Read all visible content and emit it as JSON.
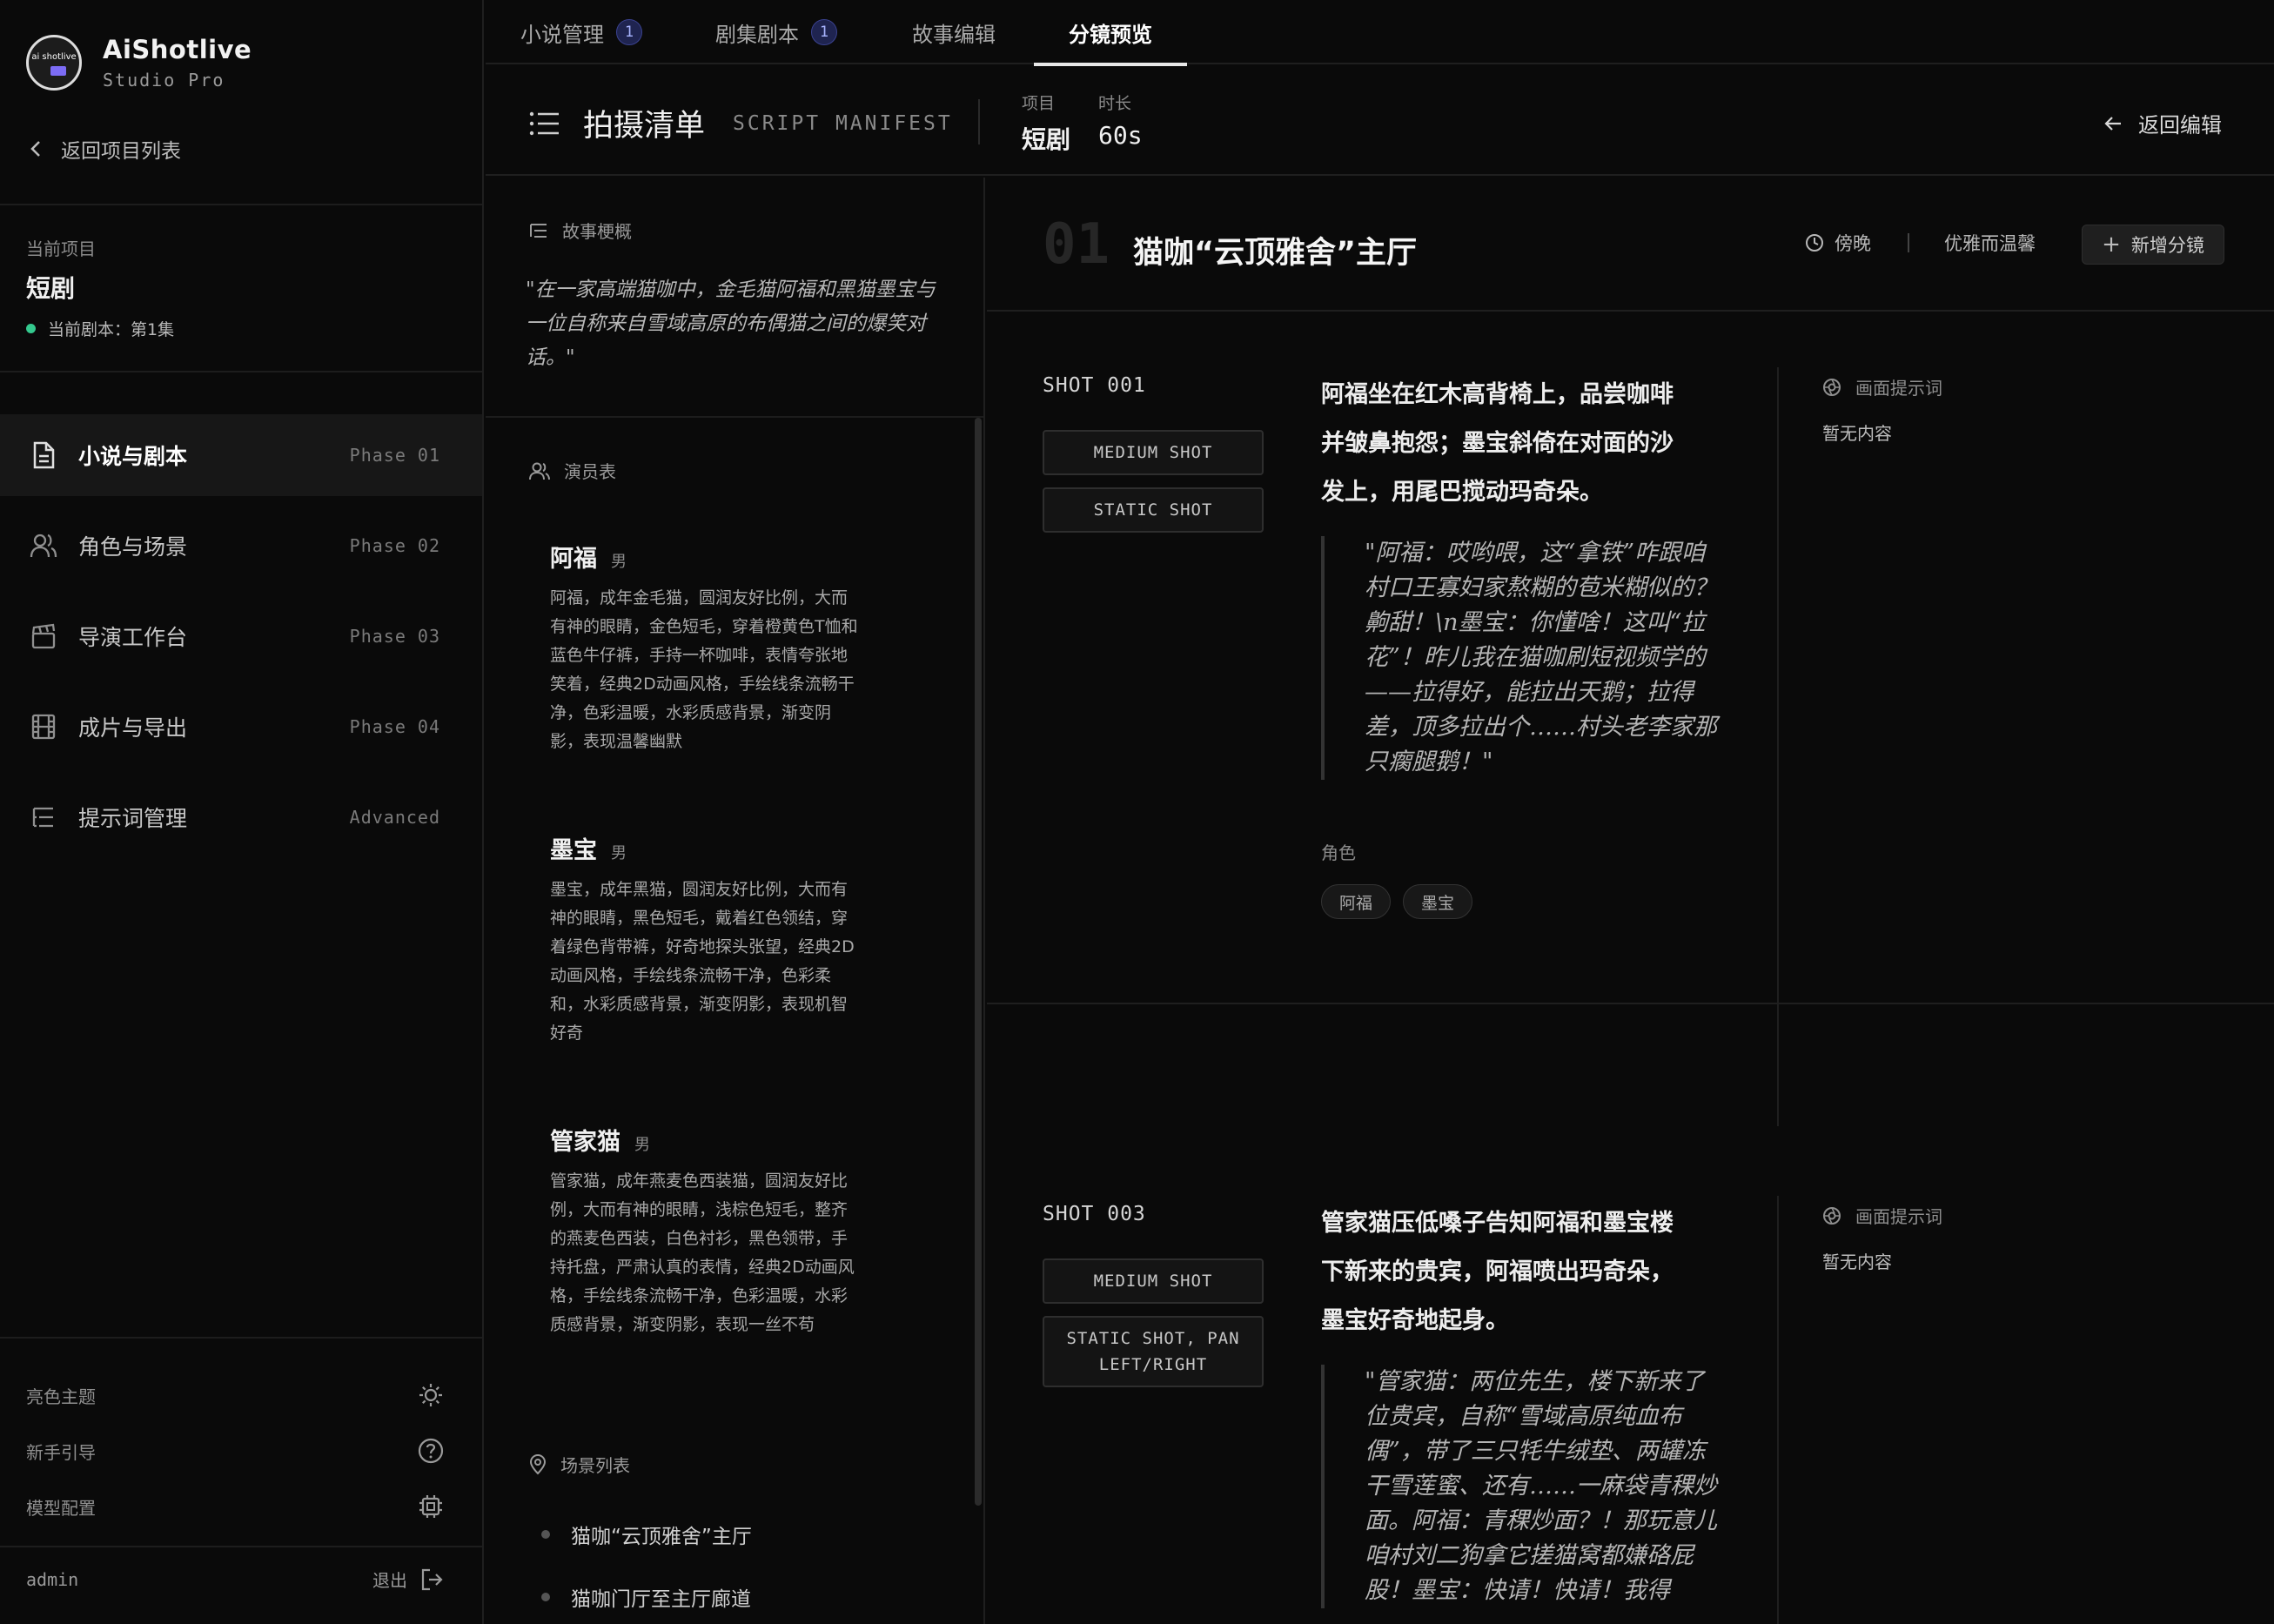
{
  "brand": {
    "name": "AiShotlive",
    "sub": "Studio Pro",
    "logo_text": "ai shotlive"
  },
  "sidebar": {
    "back_label": "返回项目列表",
    "current_label": "当前项目",
    "current_name": "短剧",
    "current_script": "当前剧本：第1集",
    "nav": [
      {
        "label": "小说与剧本",
        "phase": "Phase 01",
        "icon": "document-icon",
        "active": true
      },
      {
        "label": "角色与场景",
        "phase": "Phase 02",
        "icon": "users-icon"
      },
      {
        "label": "导演工作台",
        "phase": "Phase 03",
        "icon": "clapperboard-icon"
      },
      {
        "label": "成片与导出",
        "phase": "Phase 04",
        "icon": "film-icon"
      },
      {
        "label": "提示词管理",
        "phase": "Advanced",
        "icon": "list-tree-icon"
      }
    ],
    "util": [
      {
        "label": "亮色主题",
        "icon": "sun-icon"
      },
      {
        "label": "新手引导",
        "icon": "help-circle-icon"
      },
      {
        "label": "模型配置",
        "icon": "chip-icon"
      }
    ],
    "user": "admin",
    "logout": "退出"
  },
  "tabs": [
    {
      "label": "小说管理",
      "badge": "1"
    },
    {
      "label": "剧集剧本",
      "badge": "1"
    },
    {
      "label": "故事编辑",
      "badge": ""
    },
    {
      "label": "分镜预览",
      "badge": "",
      "active": true
    }
  ],
  "header": {
    "title": "拍摄清单",
    "subtitle": "SCRIPT MANIFEST",
    "project_key": "项目",
    "project_val": "短剧",
    "duration_key": "时长",
    "duration_val": "60s",
    "back_edit": "返回编辑"
  },
  "story": {
    "synopsis_head": "故事梗概",
    "synopsis": "\"在一家高端猫咖中，金毛猫阿福和黑猫墨宝与一位自称来自雪域高原的布偶猫之间的爆笑对话。\"",
    "cast_head": "演员表",
    "cast": [
      {
        "name": "阿福",
        "gender": "男",
        "desc": "阿福，成年金毛猫，圆润友好比例，大而有神的眼睛，金色短毛，穿着橙黄色T恤和蓝色牛仔裤，手持一杯咖啡，表情夸张地笑着，经典2D动画风格，手绘线条流畅干净，色彩温暖，水彩质感背景，渐变阴影，表现温馨幽默"
      },
      {
        "name": "墨宝",
        "gender": "男",
        "desc": "墨宝，成年黑猫，圆润友好比例，大而有神的眼睛，黑色短毛，戴着红色领结，穿着绿色背带裤，好奇地探头张望，经典2D动画风格，手绘线条流畅干净，色彩柔和，水彩质感背景，渐变阴影，表现机智好奇"
      },
      {
        "name": "管家猫",
        "gender": "男",
        "desc": "管家猫，成年燕麦色西装猫，圆润友好比例，大而有神的眼睛，浅棕色短毛，整齐的燕麦色西装，白色衬衫，黑色领带，手持托盘，严肃认真的表情，经典2D动画风格，手绘线条流畅干净，色彩温暖，水彩质感背景，渐变阴影，表现一丝不苟"
      }
    ],
    "scene_head": "场景列表",
    "scenes": [
      "猫咖“云顶雅舍”主厅",
      "猫咖门厅至主厅廊道"
    ]
  },
  "scene": {
    "number": "01",
    "title": "猫咖“云顶雅舍”主厅",
    "time": "傍晚",
    "mood": "优雅而温馨",
    "add_label": "新增分镜"
  },
  "shots": [
    {
      "id": "SHOT 001",
      "tags": [
        "MEDIUM SHOT",
        "STATIC SHOT"
      ],
      "desc": "阿福坐在红木高背椅上，品尝咖啡并皱鼻抱怨；墨宝斜倚在对面的沙发上，用尾巴搅动玛奇朵。",
      "quote": "\"阿福：哎哟喂，这“拿铁”咋跟咱村口王寡妇家熬糊的苞米糊似的？齁甜！\\n墨宝：你懂啥！这叫“拉花”！昨儿我在猫咖刷短视频学的——拉得好，能拉出天鹅；拉得差，顶多拉出个……村头老李家那只瘸腿鹅！\"",
      "roles_label": "角色",
      "roles": [
        "阿福",
        "墨宝"
      ],
      "prompt_head": "画面提示词",
      "prompt": "暂无内容"
    },
    {
      "id": "SHOT 003",
      "tags": [
        "MEDIUM SHOT",
        "STATIC SHOT, PAN LEFT/RIGHT"
      ],
      "desc": "管家猫压低嗓子告知阿福和墨宝楼下新来的贵宾，阿福喷出玛奇朵，墨宝好奇地起身。",
      "quote": "\"管家猫：两位先生，楼下新来了位贵宾，自称“雪域高原纯血布偶”，带了三只牦牛绒垫、两罐冻干雪莲蜜、还有……一麻袋青稞炒面。阿福：青稞炒面？！那玩意儿咱村刘二狗拿它搓猫窝都嫌硌屁股！墨宝：快请！快请！我得",
      "prompt_head": "画面提示词",
      "prompt": "暂无内容"
    }
  ]
}
